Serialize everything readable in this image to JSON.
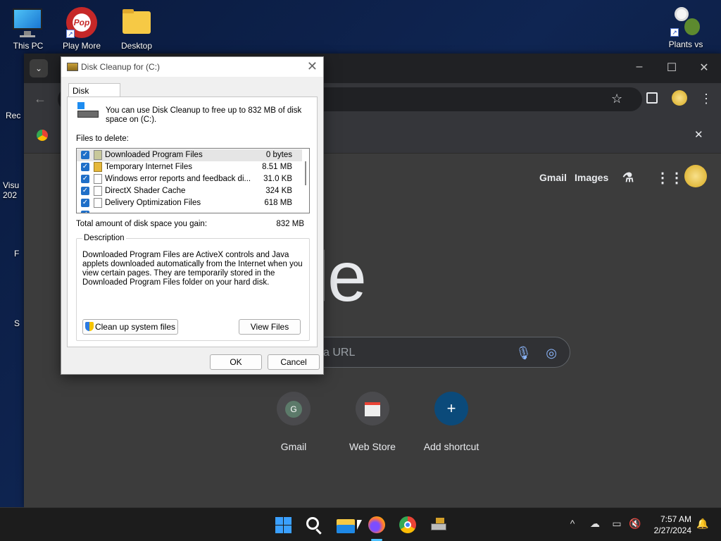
{
  "desktop": {
    "icons": [
      {
        "label": "This PC",
        "icon": "monitor-icon"
      },
      {
        "label": "Play More",
        "icon": "popcap-icon"
      },
      {
        "label": "Desktop",
        "icon": "folder-icon"
      },
      {
        "label": "Plants vs",
        "icon": "plants-icon"
      }
    ],
    "left_partial_labels": [
      "Rec",
      "Visu",
      "202",
      "F",
      "S"
    ]
  },
  "chrome": {
    "tab_dropdown_icon": "chevron-down-icon",
    "minimize": "–",
    "maximize": "☐",
    "close": "✕",
    "top_links": {
      "gmail": "Gmail",
      "images": "Images"
    },
    "logo_partial": "oogle",
    "search_placeholder_partial": "a URL",
    "shortcuts": [
      {
        "label": "Gmail",
        "glyph": "G"
      },
      {
        "label": "Web Store",
        "glyph": "🛍"
      },
      {
        "label": "Add shortcut",
        "glyph": "+"
      }
    ],
    "bookmark_bar_close": "✕"
  },
  "dialog": {
    "title": "Disk Cleanup for  (C:)",
    "close": "✕",
    "tab": "Disk Cleanup",
    "intro": "You can use Disk Cleanup to free up to 832 MB of disk space on  (C:).",
    "files_to_delete_label": "Files to delete:",
    "files": [
      {
        "name": "Downloaded Program Files",
        "size": "0 bytes",
        "checked": true,
        "selected": true
      },
      {
        "name": "Temporary Internet Files",
        "size": "8.51 MB",
        "checked": true,
        "selected": false
      },
      {
        "name": "Windows error reports and feedback di...",
        "size": "31.0 KB",
        "checked": true,
        "selected": false
      },
      {
        "name": "DirectX Shader Cache",
        "size": "324 KB",
        "checked": true,
        "selected": false
      },
      {
        "name": "Delivery Optimization Files",
        "size": "618 MB",
        "checked": true,
        "selected": false
      }
    ],
    "total_label": "Total amount of disk space you gain:",
    "total_value": "832 MB",
    "description_legend": "Description",
    "description_text": "Downloaded Program Files are ActiveX controls and Java applets downloaded automatically from the Internet when you view certain pages. They are temporarily stored in the Downloaded Program Files folder on your hard disk.",
    "cleanup_system_button": "Clean up system files",
    "view_files_button": "View Files",
    "ok_button": "OK",
    "cancel_button": "Cancel"
  },
  "taskbar": {
    "apps": [
      "start-icon",
      "search-icon",
      "file-explorer-icon",
      "firefox-icon",
      "chrome-icon",
      "disk-cleanup-icon"
    ],
    "tray": {
      "chevron": "^",
      "time": "7:57 AM",
      "date": "2/27/2024"
    }
  }
}
